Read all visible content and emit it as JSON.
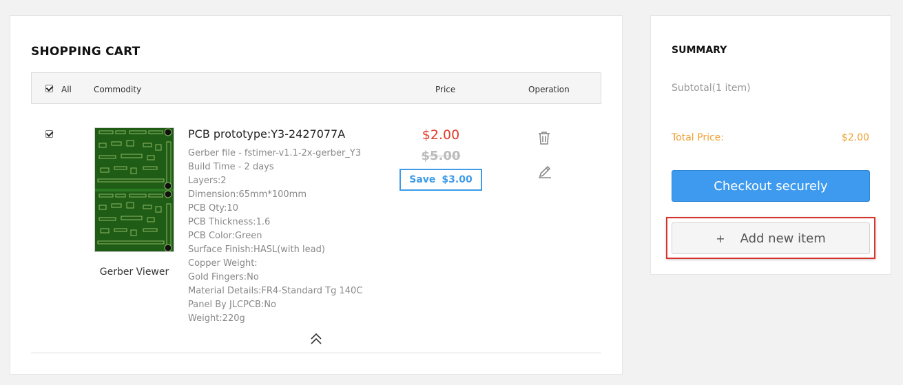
{
  "cart": {
    "title": "SHOPPING CART",
    "header": {
      "all_label": "All",
      "commodity_label": "Commodity",
      "price_label": "Price",
      "operation_label": "Operation"
    },
    "item": {
      "name": "PCB prototype:Y3-2427077A",
      "gerber_viewer_label": "Gerber Viewer",
      "specs": [
        "Gerber file - fstimer-v1.1-2x-gerber_Y3",
        "Build Time - 2 days",
        "Layers:2",
        "Dimension:65mm*100mm",
        "PCB Qty:10",
        "PCB Thickness:1.6",
        "PCB Color:Green",
        "Surface Finish:HASL(with lead)",
        "Copper Weight:",
        "Gold Fingers:No",
        "Material Details:FR4-Standard Tg 140C",
        "Panel By JLCPCB:No",
        "Weight:220g"
      ],
      "price": "$2.00",
      "original_price": "$5.00",
      "save_label": "Save",
      "save_amount": "$3.00"
    },
    "icons": {
      "delete": "trash-icon",
      "edit": "pencil-icon",
      "collapse": "double-chevron-up-icon"
    }
  },
  "summary": {
    "title": "SUMMARY",
    "subtotal": "Subtotal(1 item)",
    "total_label": "Total Price:",
    "total_value": "$2.00",
    "checkout_label": "Checkout securely",
    "add_plus": "+",
    "add_label": "Add new item"
  },
  "colors": {
    "price_red": "#e23b2a",
    "accent_blue": "#3d9aef",
    "total_orange": "#f0a030",
    "highlight_red": "#d9342b",
    "pcb_green": "#1f5d17"
  }
}
